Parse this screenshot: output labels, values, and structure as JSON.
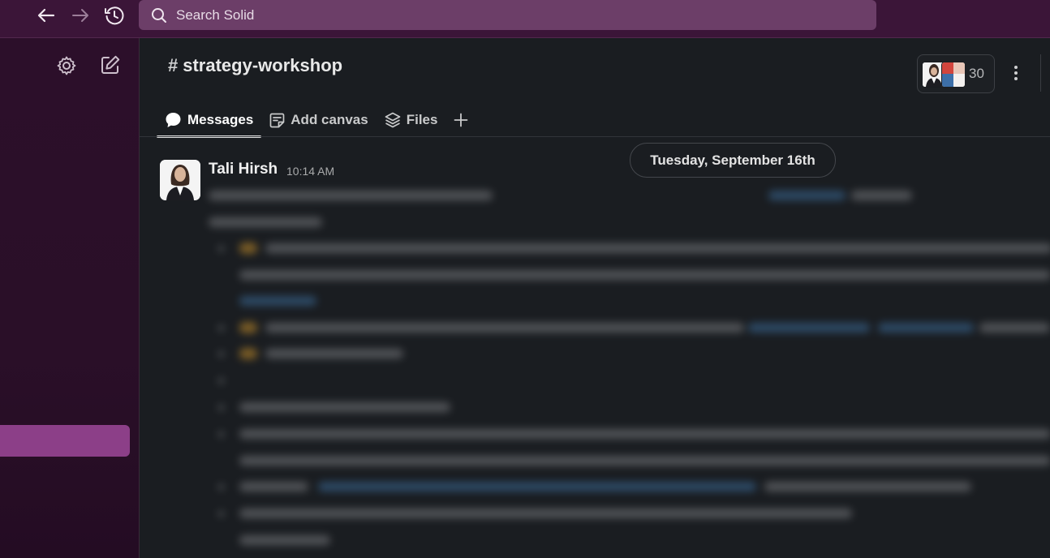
{
  "search": {
    "placeholder": "Search Solid"
  },
  "channel": {
    "hash": "#",
    "name": "strategy-workshop"
  },
  "members": {
    "count": "30"
  },
  "tabs": [
    {
      "label": "Messages",
      "active": true
    },
    {
      "label": "Add canvas",
      "active": false
    },
    {
      "label": "Files",
      "active": false
    }
  ],
  "date_divider": "Tuesday, September 16th",
  "message": {
    "author": "Tali Hirsh",
    "time": "10:14 AM"
  },
  "colors": {
    "topbar": "#3b1538",
    "search": "#6c3e68",
    "sidebar": "#2c0f2a",
    "active_channel": "#8c3f88",
    "background": "#1a1d21"
  },
  "icons": [
    "back-arrow-icon",
    "forward-arrow-icon",
    "history-icon",
    "search-icon",
    "gear-icon",
    "compose-icon",
    "kebab-menu-icon",
    "chat-bubble-icon",
    "canvas-icon",
    "files-layers-icon",
    "plus-icon"
  ]
}
